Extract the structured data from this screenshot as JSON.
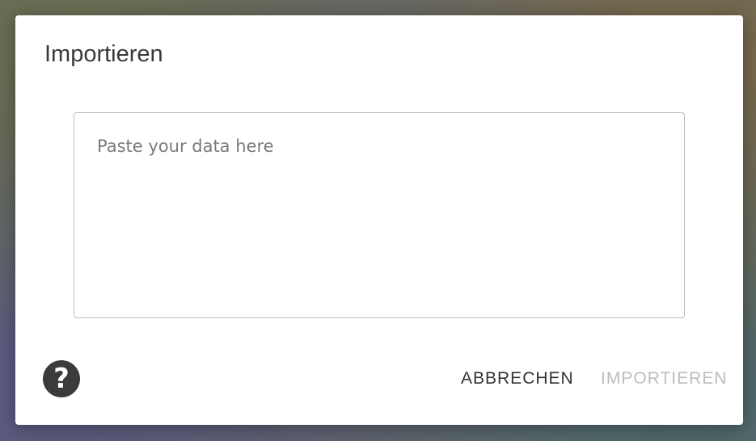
{
  "dialog": {
    "title": "Importieren",
    "textarea": {
      "value": "",
      "placeholder": "Paste your data here"
    },
    "help": {
      "icon": "help-circle-icon",
      "glyph": "?"
    },
    "actions": {
      "cancel_label": "ABBRECHEN",
      "import_label": "IMPORTIEREN",
      "import_disabled": true
    }
  },
  "colors": {
    "dialog_background": "#ffffff",
    "title_text": "#3a3a3a",
    "help_button": "#3b3b3b",
    "cancel_text": "#333333",
    "disabled_text": "#bdbdbd",
    "textarea_border": "#bdbdbd"
  }
}
